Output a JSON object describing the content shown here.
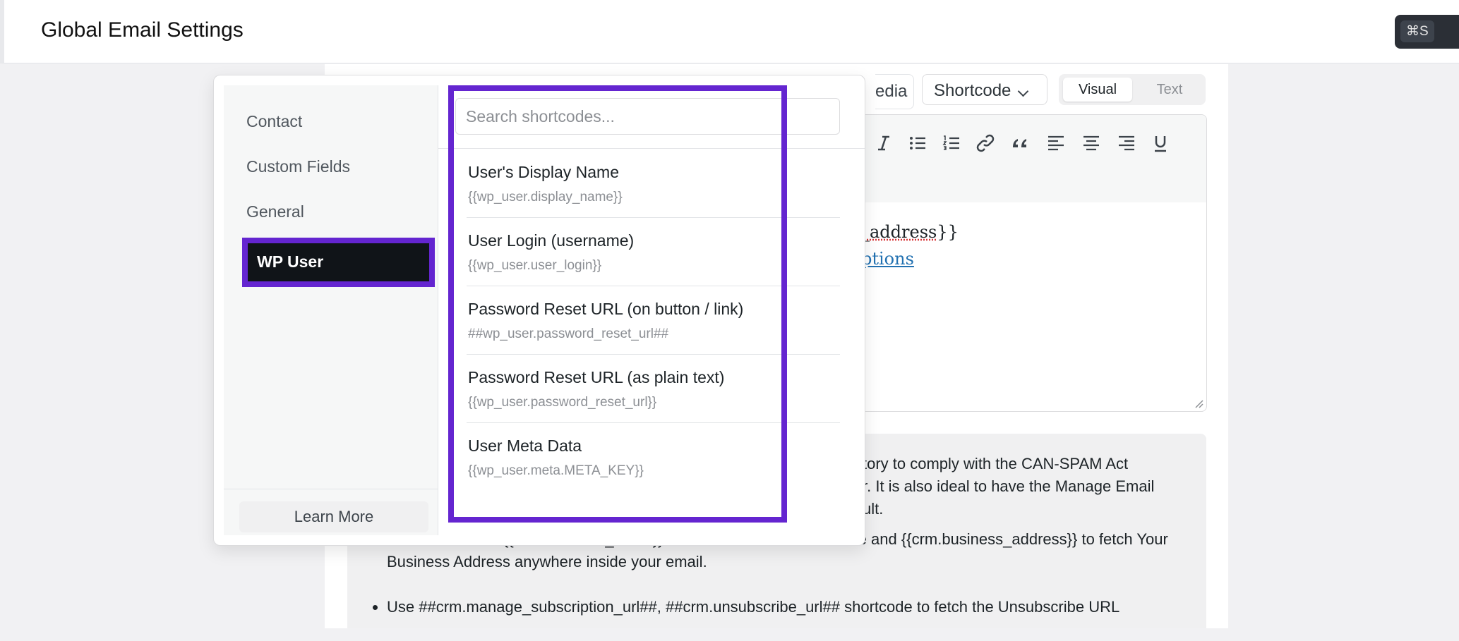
{
  "header": {
    "title": "Global Email Settings",
    "save_shortcut": "⌘S"
  },
  "editor": {
    "media_button_partial": "edia",
    "shortcode_button": "Shortcode",
    "tabs": {
      "visual": "Visual",
      "text": "Text"
    },
    "active_tab": "Visual",
    "toolbar_icons": [
      "italic-icon",
      "bullet-list-icon",
      "numbered-list-icon",
      "link-icon",
      "blockquote-icon",
      "align-left-icon",
      "align-center-icon",
      "align-right-icon",
      "underline-icon"
    ],
    "content_line1_prefix": "_",
    "content_line1_word": "address",
    "content_line1_suffix": "}}",
    "content_line2": "ptions"
  },
  "notice": {
    "paragraph": [
      "tory to comply with the CAN-SPAM Act",
      "r. It is also ideal to have the Manage Email",
      "ult."
    ],
    "bullets": [
      "Use shortcodes: {{crm.business_name}} to fetch Your Business Name and {{crm.business_address}} to fetch Your Business Address anywhere inside your email.",
      "Use ##crm.manage_subscription_url##, ##crm.unsubscribe_url## shortcode to fetch the Unsubscribe URL"
    ]
  },
  "shortcode_popover": {
    "groups": [
      "Contact",
      "Custom Fields",
      "General",
      "WP User"
    ],
    "active_group": "WP User",
    "learn_more": "Learn More",
    "search_placeholder": "Search shortcodes...",
    "search_value": "",
    "items": [
      {
        "label": "User's Display Name",
        "code": "{{wp_user.display_name}}"
      },
      {
        "label": "User Login (username)",
        "code": "{{wp_user.user_login}}"
      },
      {
        "label": "Password Reset URL (on button / link)",
        "code": "##wp_user.password_reset_url##"
      },
      {
        "label": "Password Reset URL (as plain text)",
        "code": "{{wp_user.password_reset_url}}"
      },
      {
        "label": "User Meta Data",
        "code": "{{wp_user.meta.META_KEY}}"
      }
    ]
  },
  "colors": {
    "highlight": "#6425d0",
    "active_group_bg": "#101418",
    "link": "#2271b1"
  }
}
